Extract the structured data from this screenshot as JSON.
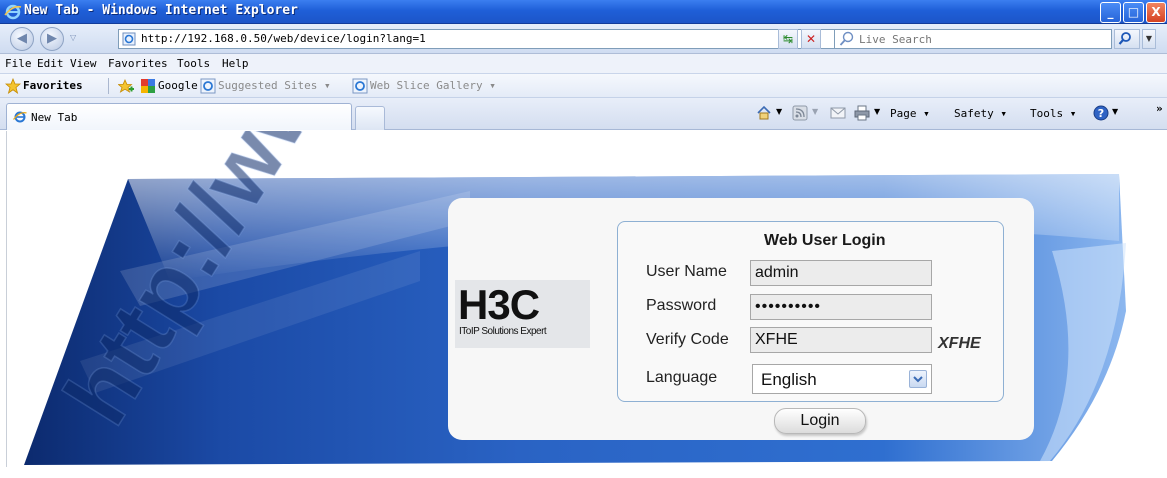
{
  "window": {
    "title": "New Tab - Windows Internet Explorer",
    "buttons": {
      "minimize": "_",
      "maximize": "□",
      "close": "X"
    }
  },
  "address_bar": {
    "url": "http://192.168.0.50/web/device/login?lang=1",
    "search_placeholder": "Live Search"
  },
  "menu": [
    "File",
    "Edit",
    "View",
    "Favorites",
    "Tools",
    "Help"
  ],
  "favorites_bar": {
    "favorites_label": "Favorites",
    "items": [
      {
        "label": "Google",
        "muted": false
      },
      {
        "label": "Suggested Sites ▾",
        "muted": true
      },
      {
        "label": "Web Slice Gallery ▾",
        "muted": true
      }
    ]
  },
  "tabs": [
    {
      "label": "New Tab",
      "active": true
    }
  ],
  "command_bar": {
    "page": "Page ▾",
    "safety": "Safety ▾",
    "tools": "Tools ▾",
    "more": "»"
  },
  "login": {
    "title": "Web User Login",
    "logo": {
      "mark": "H3C",
      "tagline": "IToIP Solutions Expert"
    },
    "user_name_label": "User Name",
    "user_name_value": "admin",
    "password_label": "Password",
    "password_value": "••••••••••",
    "verify_code_label": "Verify Code",
    "verify_code_value": "XFHE",
    "captcha_text": "XFHE",
    "language_label": "Language",
    "language_value": "English",
    "login_button": "Login"
  },
  "colors": {
    "titlebar": "#1f5fd8",
    "banner_blue": "#1a4fb4",
    "form_border": "#8eb0d3"
  }
}
